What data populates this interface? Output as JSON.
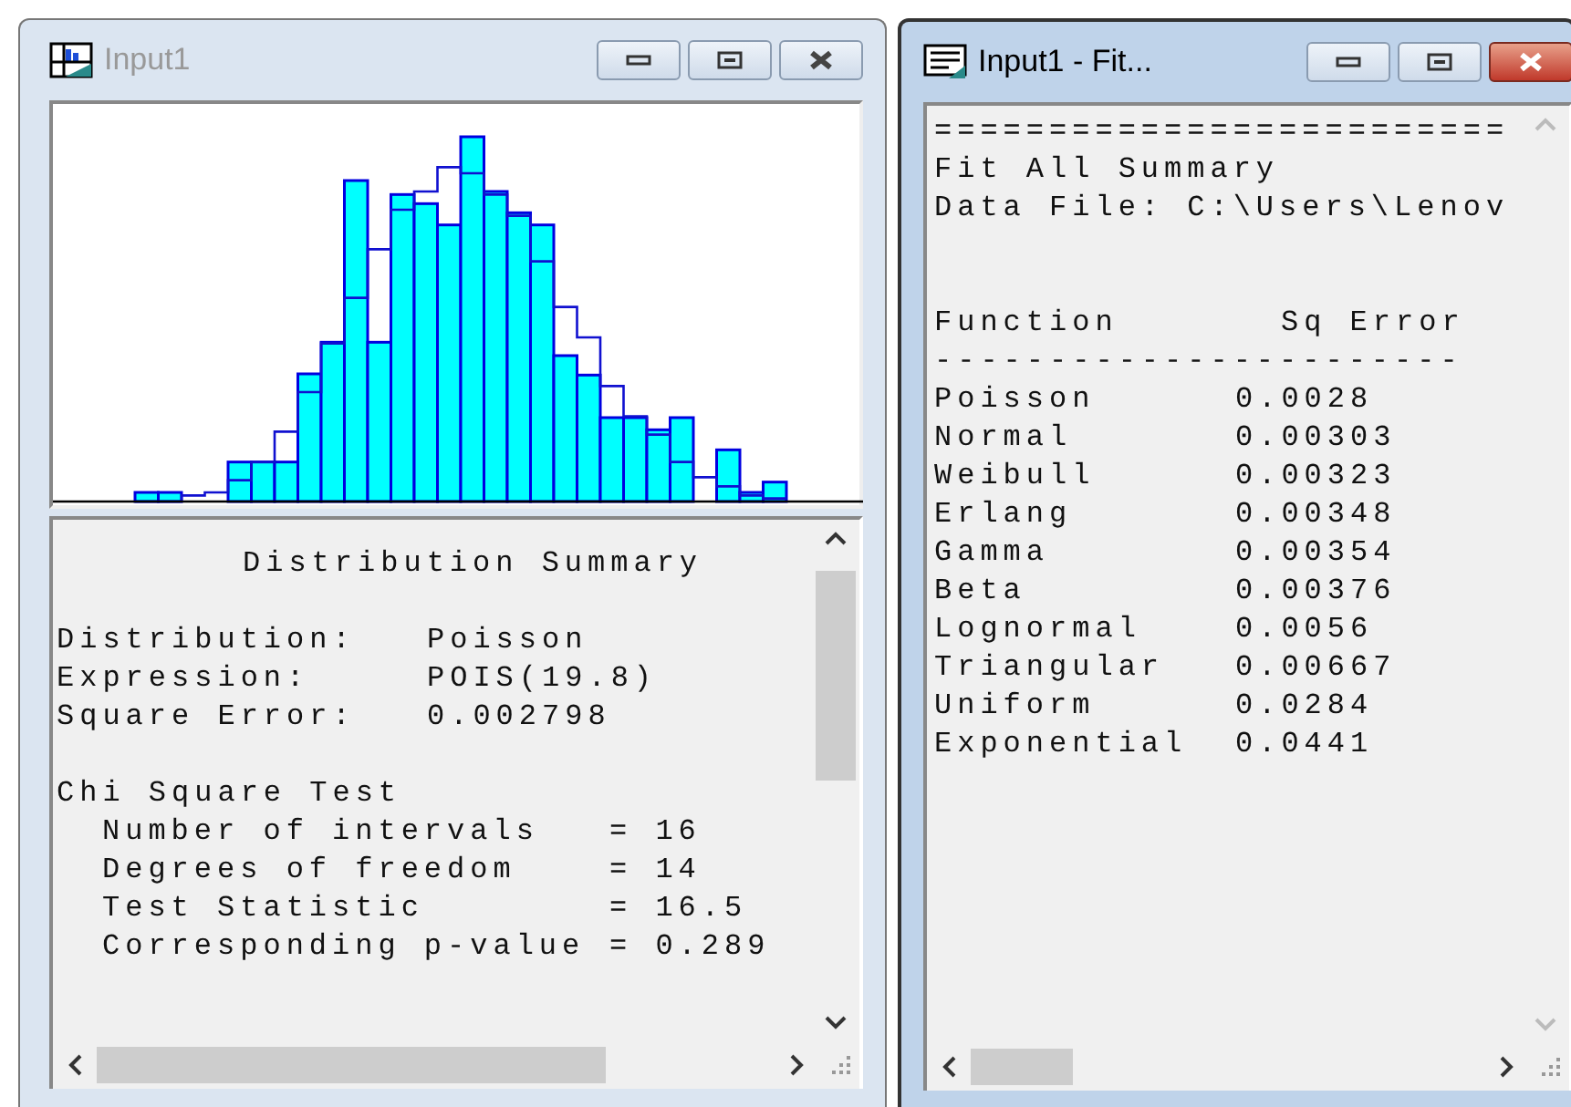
{
  "windows": [
    {
      "kind": "histogram",
      "title": "Input1",
      "active": false,
      "summary": {
        "title": "Distribution Summary",
        "fields": [
          {
            "label": "Distribution:",
            "value": "Poisson"
          },
          {
            "label": "Expression:",
            "value": "POIS(19.8)"
          },
          {
            "label": "Square Error:",
            "value": "0.002798"
          }
        ],
        "test_title": "Chi Square Test",
        "stats": [
          {
            "label": "Number of intervals",
            "value": "= 16"
          },
          {
            "label": "Degrees of freedom",
            "value": "= 14"
          },
          {
            "label": "Test Statistic",
            "value": "= 16.5"
          },
          {
            "label": "Corresponding p-value",
            "value": "= 0.289"
          }
        ]
      }
    },
    {
      "kind": "report",
      "title": "Input1 - Fit...",
      "active": true,
      "header_lines": [
        "=========================",
        "Fit All Summary",
        "Data File: C:\\Users\\Lenov"
      ],
      "columns": [
        "Function",
        "Sq Error"
      ],
      "rule": "-----------------------",
      "rows": [
        {
          "function": "Poisson",
          "error": "0.0028"
        },
        {
          "function": "Normal",
          "error": "0.00303"
        },
        {
          "function": "Weibull",
          "error": "0.00323"
        },
        {
          "function": "Erlang",
          "error": "0.00348"
        },
        {
          "function": "Gamma",
          "error": "0.00354"
        },
        {
          "function": "Beta",
          "error": "0.00376"
        },
        {
          "function": "Lognormal",
          "error": "0.0056"
        },
        {
          "function": "Triangular",
          "error": "0.00667"
        },
        {
          "function": "Uniform",
          "error": "0.0284"
        },
        {
          "function": "Exponential",
          "error": "0.0441"
        }
      ]
    }
  ]
}
